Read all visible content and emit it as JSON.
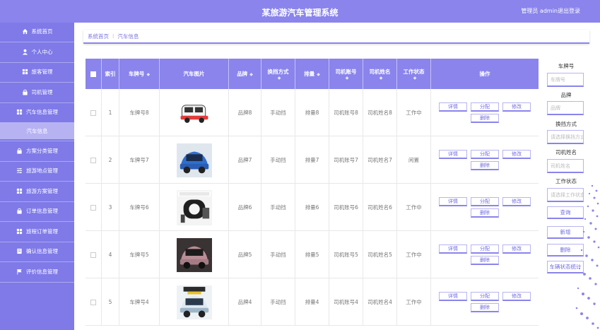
{
  "header": {
    "title": "某旅游汽车管理系统",
    "user": "管理员 admin",
    "logout": "退出登录"
  },
  "sidebar": {
    "items": [
      {
        "label": "系统首页",
        "icon": "home-icon"
      },
      {
        "label": "个人中心",
        "icon": "user-icon"
      },
      {
        "label": "旅客管理",
        "icon": "grid-icon"
      },
      {
        "label": "司机管理",
        "icon": "lock-icon"
      },
      {
        "label": "汽车信息管理",
        "icon": "grid-icon"
      },
      {
        "label": "汽车信息",
        "icon": ""
      },
      {
        "label": "方案分类管理",
        "icon": "lock-icon"
      },
      {
        "label": "旅游地点管理",
        "icon": "sliders-icon"
      },
      {
        "label": "旅游方案管理",
        "icon": "grid-icon"
      },
      {
        "label": "订单信息管理",
        "icon": "lock-icon"
      },
      {
        "label": "旅程订单管理",
        "icon": "grid-icon"
      },
      {
        "label": "确认信息管理",
        "icon": "book-icon"
      },
      {
        "label": "评价信息管理",
        "icon": "flag-icon"
      }
    ]
  },
  "breadcrumb": {
    "home": "系统首页",
    "sep": "⁝",
    "current": "汽车信息"
  },
  "table": {
    "headers": {
      "index": "索引",
      "plate": "车牌号",
      "image": "汽车图片",
      "brand": "品牌",
      "gear": "换挡方式",
      "displacement": "排量",
      "driver_account": "司机账号",
      "driver_name": "司机姓名",
      "status": "工作状态",
      "ops": "操作"
    },
    "sort_glyph": "◆",
    "op_labels": {
      "detail": "详情",
      "assign": "分配",
      "edit": "修改",
      "delete": "删除"
    },
    "rows": [
      {
        "index": "1",
        "plate": "车牌号8",
        "brand": "品牌8",
        "gear": "手动挡",
        "displacement": "排量8",
        "driver_account": "司机账号8",
        "driver_name": "司机姓名8",
        "status": "工作中"
      },
      {
        "index": "2",
        "plate": "车牌号7",
        "brand": "品牌7",
        "gear": "手动挡",
        "displacement": "排量7",
        "driver_account": "司机账号7",
        "driver_name": "司机姓名7",
        "status": "闲置"
      },
      {
        "index": "3",
        "plate": "车牌号6",
        "brand": "品牌6",
        "gear": "手动挡",
        "displacement": "排量6",
        "driver_account": "司机账号6",
        "driver_name": "司机姓名6",
        "status": "工作中"
      },
      {
        "index": "4",
        "plate": "车牌号5",
        "brand": "品牌5",
        "gear": "手动挡",
        "displacement": "排量5",
        "driver_account": "司机账号5",
        "driver_name": "司机姓名5",
        "status": "工作中"
      },
      {
        "index": "5",
        "plate": "车牌号4",
        "brand": "品牌4",
        "gear": "手动挡",
        "displacement": "排量4",
        "driver_account": "司机账号4",
        "driver_name": "司机姓名4",
        "status": "工作中"
      }
    ]
  },
  "filter": {
    "plate_label": "车牌号",
    "plate_placeholder": "车牌号",
    "brand_label": "品牌",
    "brand_placeholder": "品牌",
    "gear_label": "换挡方式",
    "gear_placeholder": "请选择换挡方式",
    "driver_label": "司机姓名",
    "driver_placeholder": "司机姓名",
    "status_label": "工作状态",
    "status_placeholder": "请选择工作状态",
    "search": "查询",
    "add": "新增",
    "delete": "删除",
    "stats": "车辆状态统计"
  },
  "colors": {
    "accent": "#8a84ec",
    "sidebar": "#7f7ae8",
    "active": "#b7b3f3"
  }
}
